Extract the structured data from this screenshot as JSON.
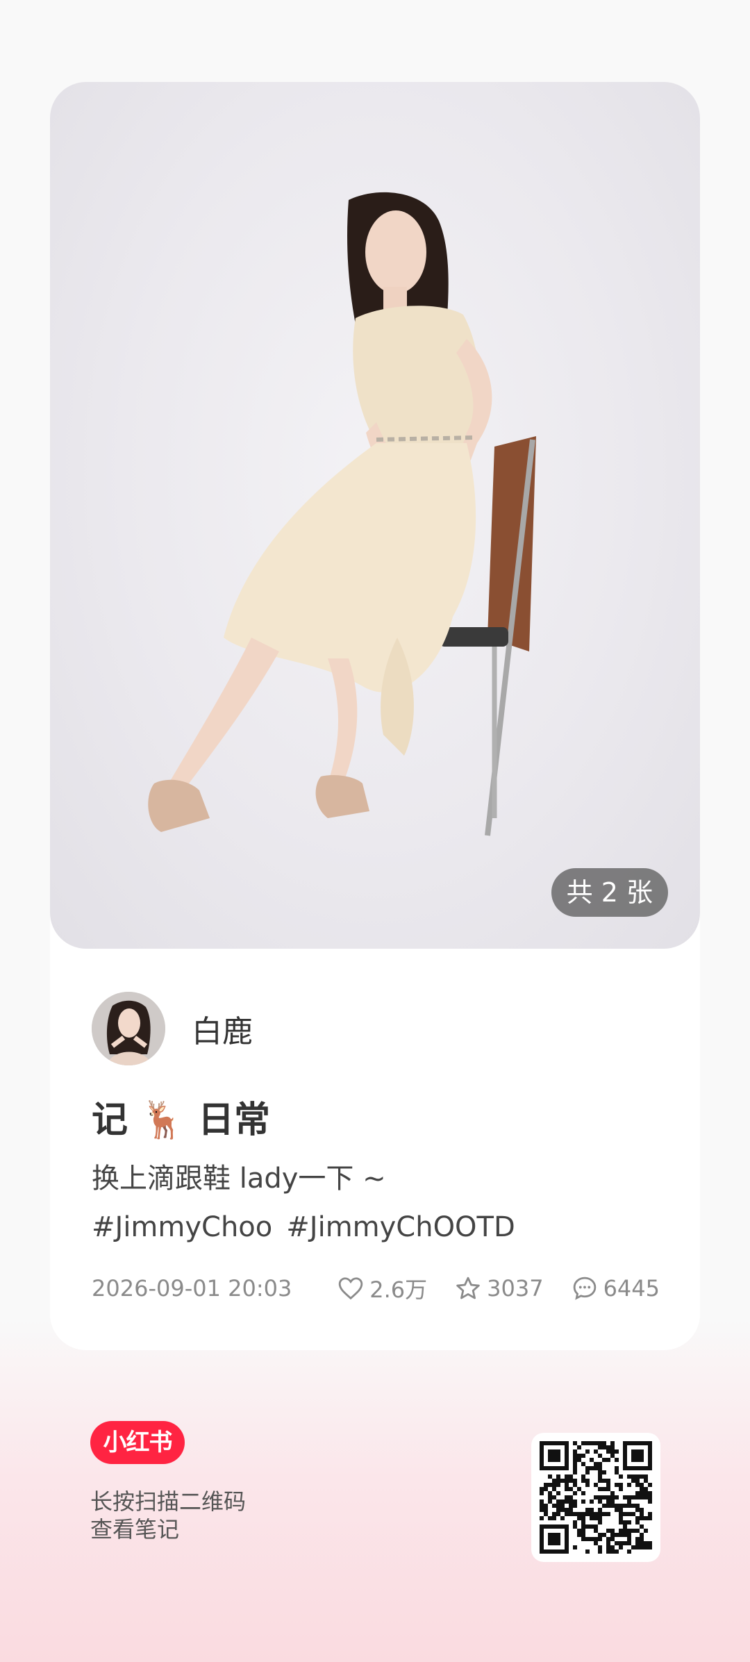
{
  "post": {
    "image_count_label": "共 2 张",
    "author_name": "白鹿",
    "title_part1": "记",
    "title_emoji": "🦌",
    "title_part2": "日常",
    "body": "换上滴跟鞋 lady一下 ~",
    "tags": [
      "#JimmyChoo",
      "#JimmyChOOTD"
    ],
    "date": "2026-09-01 20:03",
    "likes": "2.6万",
    "favorites": "3037",
    "comments": "6445"
  },
  "footer": {
    "brand_label": "小红书",
    "hint_line1": "长按扫描二维码",
    "hint_line2": "查看笔记"
  },
  "icons": {
    "like": "heart-icon",
    "favorite": "star-icon",
    "comment": "comment-icon"
  },
  "colors": {
    "brand": "#ff2442",
    "meta_text": "#8a8a8a"
  }
}
